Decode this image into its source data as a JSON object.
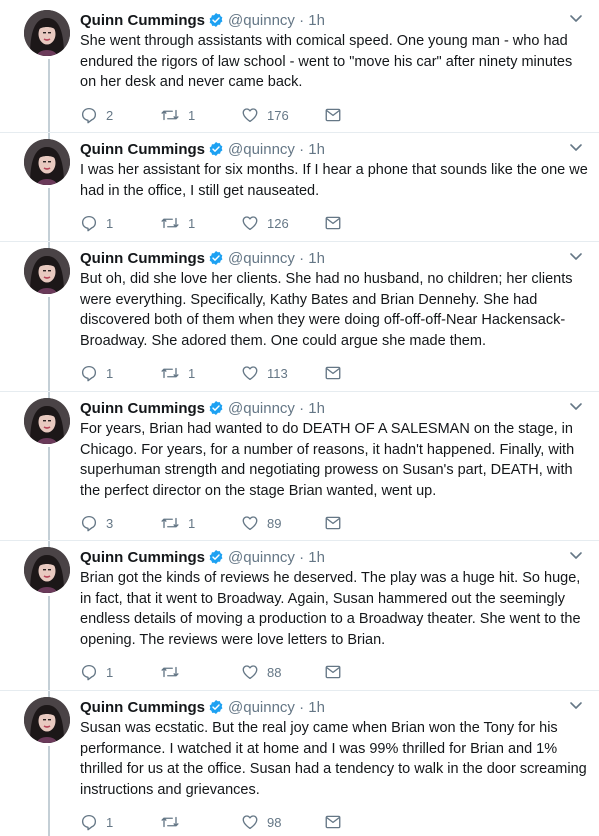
{
  "author": {
    "name": "Quinn Cummings",
    "handle": "@quinncy",
    "dot": "·",
    "time": "1h"
  },
  "colors": {
    "verified": "#1da1f2",
    "muted": "#657786",
    "text": "#14171a"
  },
  "icons": {
    "reply": "reply-icon",
    "retweet": "retweet-icon",
    "like": "heart-icon",
    "dm": "envelope-icon",
    "more": "chevron-down-icon"
  },
  "tweets": [
    {
      "text": "She went through assistants with comical speed. One young man - who had endured the rigors of law school - went to \"move his car\" after ninety minutes on her desk and never came back.",
      "replies": "2",
      "retweets": "1",
      "likes": "176"
    },
    {
      "text": "I was her assistant for six months. If I hear a phone that sounds like the one we had in the office, I still get nauseated.",
      "replies": "1",
      "retweets": "1",
      "likes": "126"
    },
    {
      "text": "But oh, did she love her clients. She had no husband, no children; her clients were everything. Specifically, Kathy Bates and Brian Dennehy. She had discovered both of them when they were doing off-off-off-Near Hackensack-Broadway. She adored them. One could argue she made them.",
      "replies": "1",
      "retweets": "1",
      "likes": "113"
    },
    {
      "text": "For years, Brian had wanted to do DEATH OF A SALESMAN on the stage, in Chicago. For years, for a number of reasons, it hadn't happened. Finally, with superhuman strength and negotiating prowess on Susan's part, DEATH, with the perfect director on the stage Brian wanted, went up.",
      "replies": "3",
      "retweets": "1",
      "likes": "89"
    },
    {
      "text": "Brian got the kinds of reviews he deserved. The play was a huge hit. So huge, in fact, that it went to Broadway. Again, Susan hammered out the seemingly endless details of moving a production to a Broadway theater. She went to the opening. The reviews were love letters to Brian.",
      "replies": "1",
      "retweets": "",
      "likes": "88"
    },
    {
      "text": "Susan was ecstatic. But the real joy came when Brian won the Tony for his performance. I watched it at home and I was 99% thrilled for Brian and 1% thrilled for us at the office. Susan had a tendency to walk in the door screaming instructions and grievances.",
      "replies": "1",
      "retweets": "",
      "likes": "98"
    }
  ]
}
